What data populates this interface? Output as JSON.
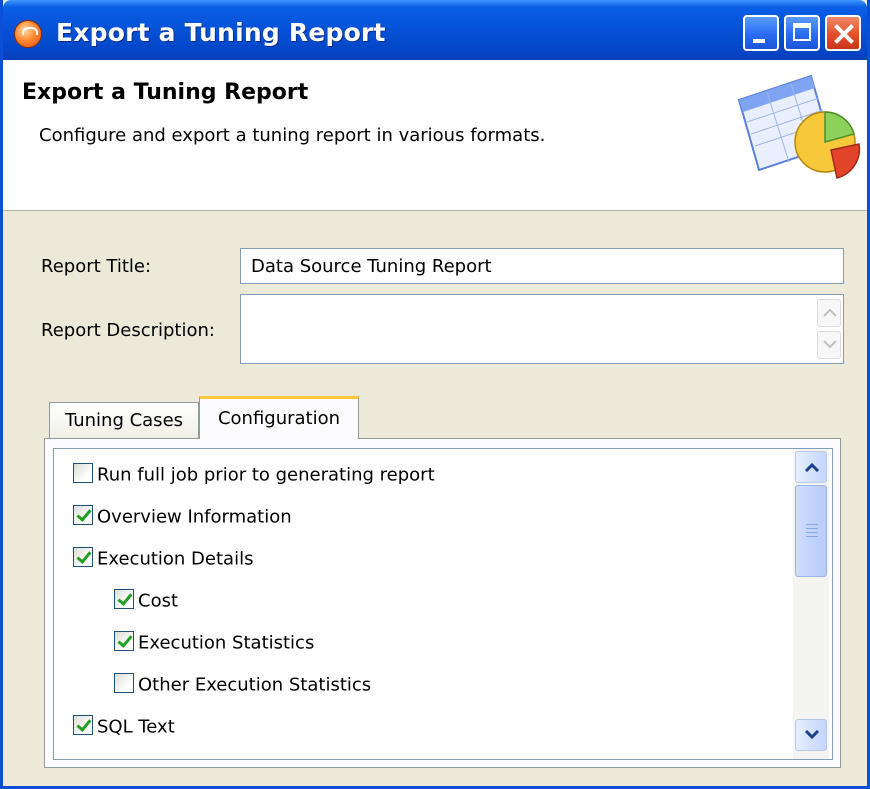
{
  "window": {
    "title": "Export a Tuning Report"
  },
  "header": {
    "title": "Export a Tuning Report",
    "subtitle": "Configure and export a tuning report in various formats."
  },
  "form": {
    "report_title_label": "Report Title:",
    "report_title_value": "Data Source Tuning Report",
    "report_description_label": "Report Description:",
    "report_description_value": ""
  },
  "tabs": [
    {
      "label": "Tuning Cases",
      "active": false
    },
    {
      "label": "Configuration",
      "active": true
    }
  ],
  "options": [
    {
      "label": "Run full job prior to generating report",
      "checked": false,
      "level": 0
    },
    {
      "label": "Overview Information",
      "checked": true,
      "level": 0
    },
    {
      "label": "Execution Details",
      "checked": true,
      "level": 0
    },
    {
      "label": "Cost",
      "checked": true,
      "level": 1
    },
    {
      "label": "Execution Statistics",
      "checked": true,
      "level": 1
    },
    {
      "label": "Other Execution Statistics",
      "checked": false,
      "level": 1
    },
    {
      "label": "SQL Text",
      "checked": true,
      "level": 0
    }
  ],
  "icons": {
    "app": "app-icon",
    "header_graphic": "report-chart-icon",
    "minimize": "minimize-icon",
    "maximize": "maximize-icon",
    "close": "close-icon"
  },
  "colors": {
    "titlebar": "#0553d8",
    "close": "#e2502a",
    "check": "#21a121",
    "active_tab_accent": "#ffc83c"
  }
}
